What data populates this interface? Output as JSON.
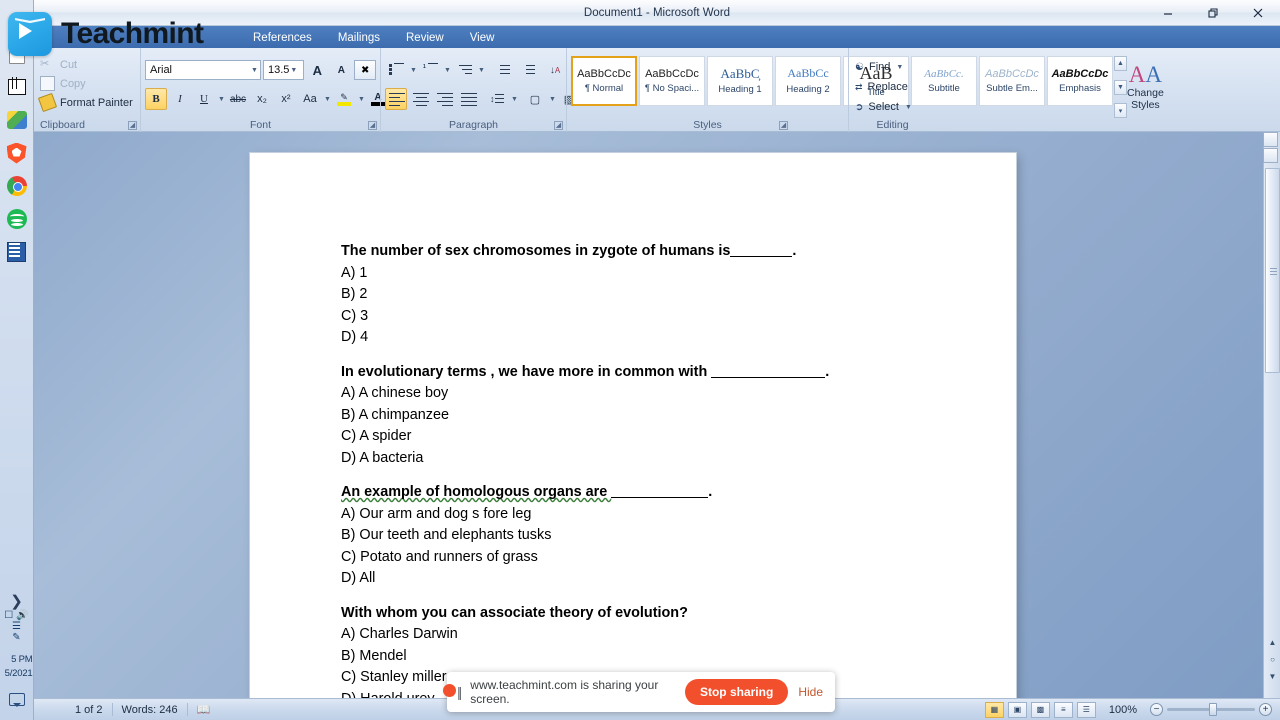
{
  "window": {
    "title": "Document1 - Microsoft Word",
    "minimize_icon": "minimize-icon",
    "restore_icon": "restore-icon",
    "close_icon": "close-icon"
  },
  "brand": {
    "name": "Teachmint",
    "logo_icon": "teachmint-logo-icon"
  },
  "ribbon": {
    "tabs": [
      {
        "label": "References"
      },
      {
        "label": "Mailings"
      },
      {
        "label": "Review"
      },
      {
        "label": "View"
      }
    ],
    "clipboard": {
      "label": "Clipboard",
      "items": [
        {
          "label": "Cut",
          "icon": "scissors-icon"
        },
        {
          "label": "Copy",
          "icon": "copy-icon"
        },
        {
          "label": "Format Painter",
          "icon": "paintbrush-icon"
        }
      ]
    },
    "font": {
      "label": "Font",
      "font_name": "Arial",
      "font_size": "13.5",
      "grow_font": "A",
      "shrink_font": "A",
      "clear_formatting": "clear-formatting-icon",
      "bold": "B",
      "italic": "I",
      "underline": "U",
      "strikethrough": "abc",
      "subscript": "x₂",
      "superscript": "x²",
      "change_case": "Aa",
      "highlight": "highlight-icon",
      "font_color": "A"
    },
    "paragraph": {
      "label": "Paragraph",
      "bullets": "bullets-icon",
      "numbering": "numbering-icon",
      "multilevel": "multilevel-list-icon",
      "decrease_indent": "decrease-indent-icon",
      "increase_indent": "increase-indent-icon",
      "sort": "sort-icon",
      "show_marks": "¶",
      "align_left": "align-left-icon",
      "align_center": "align-center-icon",
      "align_right": "align-right-icon",
      "justify": "justify-icon",
      "line_spacing": "line-spacing-icon",
      "shading": "shading-icon",
      "borders": "borders-icon"
    },
    "styles": {
      "label": "Styles",
      "gallery": [
        {
          "preview": "AaBbCcDc",
          "name": "¶ Normal",
          "selected": true
        },
        {
          "preview": "AaBbCcDc",
          "name": "¶ No Spaci...",
          "selected": false
        },
        {
          "preview": "AaBbC̦",
          "name": "Heading 1",
          "selected": false
        },
        {
          "preview": "AaBbCc",
          "name": "Heading 2",
          "selected": false
        },
        {
          "preview": "AaB",
          "name": "Title",
          "selected": false
        },
        {
          "preview": "AaBbCc.",
          "name": "Subtitle",
          "selected": false
        },
        {
          "preview": "AaBbCcDc",
          "name": "Subtle Em...",
          "selected": false
        },
        {
          "preview": "AaBbCcDc",
          "name": "Emphasis",
          "selected": false
        }
      ],
      "change_styles": "Change Styles"
    },
    "editing": {
      "label": "Editing",
      "items": [
        {
          "label": "Find",
          "icon": "binoculars-icon"
        },
        {
          "label": "Replace",
          "icon": "replace-icon"
        },
        {
          "label": "Select",
          "icon": "select-cursor-icon"
        }
      ]
    }
  },
  "document": {
    "blocks": [
      {
        "question": "The number of sex chromosomes in zygote of humans is",
        "question_tail": ".",
        "blank_width": 62,
        "options": [
          "A) 1",
          "B) 2",
          "C) 3",
          "D) 4"
        ]
      },
      {
        "question": "In evolutionary  terms , we have more in common with ",
        "question_tail": ".",
        "blank_width": 114,
        "options": [
          "A) A chinese boy",
          "B) A chimpanzee",
          "C) A spider",
          "D) A bacteria"
        ]
      },
      {
        "question": "An example of homologous organs are ",
        "question_tail": ".",
        "blank_width": 97,
        "options": [
          "A) Our arm and dog s fore leg",
          "B) Our teeth and elephants tusks",
          "C) Potato and runners of grass",
          "D) All"
        ]
      },
      {
        "question": "With whom you can associate theory of evolution?",
        "question_tail": "",
        "blank_width": 0,
        "options": [
          "A) Charles Darwin",
          "B) Mendel",
          "C) Stanley miller",
          "D) Harold urey"
        ]
      }
    ]
  },
  "status_bar": {
    "page": "1 of 2",
    "words": "Words: 246",
    "proofing_icon": "proofing-errors-icon",
    "views": [
      {
        "name": "print-layout-view",
        "selected": true
      },
      {
        "name": "full-screen-reading-view",
        "selected": false
      },
      {
        "name": "web-layout-view",
        "selected": false
      },
      {
        "name": "outline-view",
        "selected": false
      },
      {
        "name": "draft-view",
        "selected": false
      }
    ],
    "zoom": "100%",
    "zoom_out": "−",
    "zoom_in": "+"
  },
  "share_bar": {
    "message": "www.teachmint.com is sharing your screen.",
    "stop_label": "Stop sharing",
    "hide_label": "Hide",
    "accent_color": "#f2502c"
  },
  "dock": {
    "icons": [
      {
        "name": "search-icon"
      },
      {
        "name": "document-icon"
      },
      {
        "name": "calculator-icon"
      },
      {
        "name": "photos-icon"
      },
      {
        "name": "brave-browser-icon"
      },
      {
        "name": "chrome-browser-icon"
      },
      {
        "name": "spotify-icon"
      },
      {
        "name": "blue-app-icon"
      }
    ],
    "expand_icon": "chevron-right-icon",
    "tray": [
      {
        "name": "monitor-icon"
      },
      {
        "name": "volume-icon"
      },
      {
        "name": "network-icon"
      },
      {
        "name": "pen-icon"
      }
    ],
    "clock_time": "5 PM",
    "clock_date": "5/2021",
    "notification_icon": "notification-icon"
  }
}
